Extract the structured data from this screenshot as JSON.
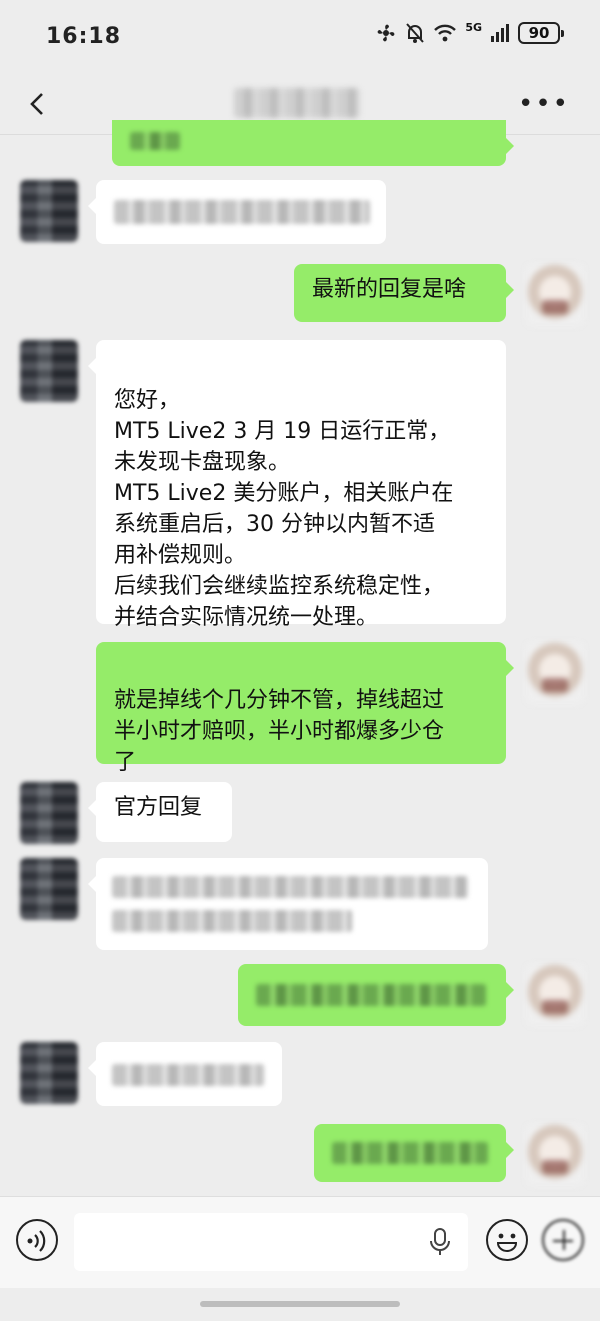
{
  "status_bar": {
    "time": "16:18",
    "battery": "90",
    "network": "5G"
  },
  "header": {
    "title_redacted": true
  },
  "messages": [
    {
      "side": "out",
      "redacted": true
    },
    {
      "side": "in",
      "redacted": true
    },
    {
      "side": "out",
      "text": "最新的回复是啥"
    },
    {
      "side": "in",
      "text": "您好，\nMT5 Live2 3 月 19 日运行正常，\n未发现卡盘现象。\nMT5 Live2 美分账户，相关账户在\n系统重启后，30 分钟以内暂不适\n用补偿规则。\n后续我们会继续监控系统稳定性，\n并结合实际情况统一处理。"
    },
    {
      "side": "out",
      "text": "就是掉线个几分钟不管，掉线超过\n半小时才赔呗，半小时都爆多少仓\n了"
    },
    {
      "side": "in",
      "text": "官方回复"
    },
    {
      "side": "in",
      "redacted": true
    },
    {
      "side": "out",
      "redacted": true
    },
    {
      "side": "in",
      "redacted": true
    },
    {
      "side": "out",
      "redacted": true
    }
  ],
  "input_bar": {
    "placeholder": ""
  },
  "icons": {
    "back": "back-arrow-icon",
    "more": "more-dots-icon",
    "voice": "voice-icon",
    "mic": "mic-icon",
    "emoji": "emoji-icon",
    "plus": "plus-icon"
  },
  "colors": {
    "background": "#ededed",
    "bubble_out": "#95ec69",
    "bubble_in": "#ffffff"
  }
}
